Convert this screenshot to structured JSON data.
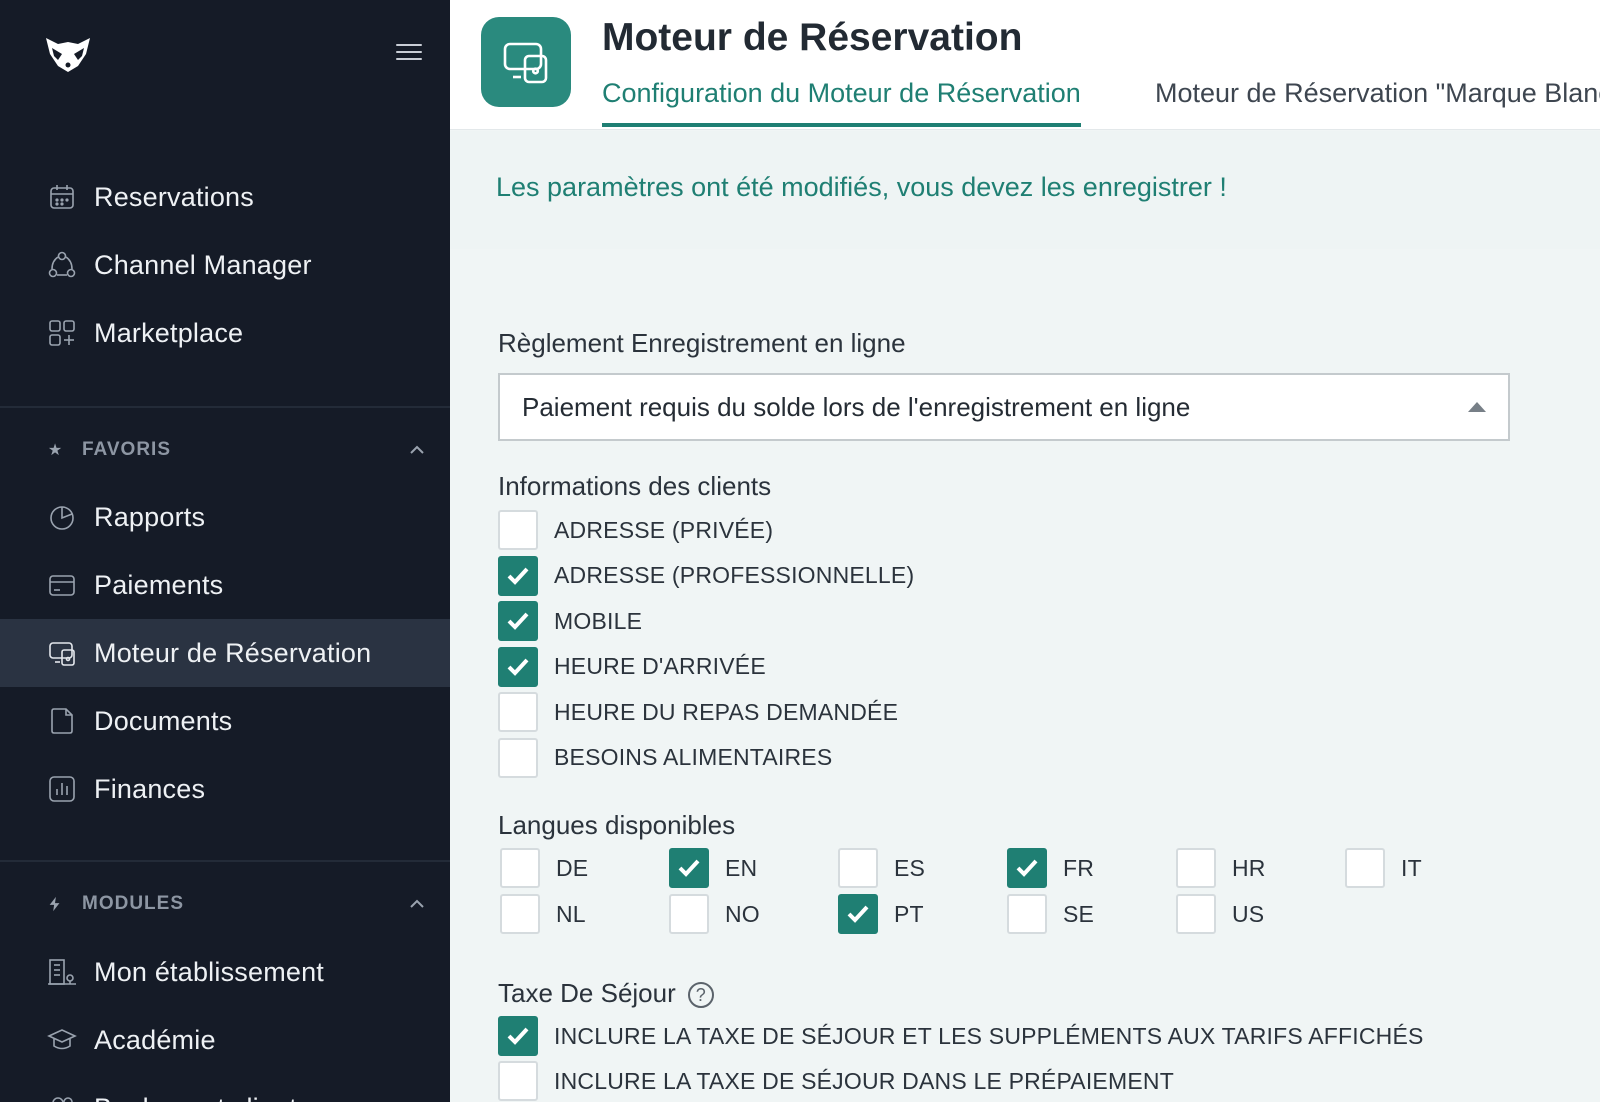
{
  "sidebar": {
    "logo_icon": "raccoon-logo-icon",
    "menu_icon": "hamburger-menu-icon",
    "top_items": [
      {
        "label": "Reservations",
        "icon": "calendar-icon"
      },
      {
        "label": "Channel Manager",
        "icon": "network-icon"
      },
      {
        "label": "Marketplace",
        "icon": "apps-grid-icon"
      }
    ],
    "favorites": {
      "title": "FAVORIS",
      "icon": "star-icon",
      "items": [
        {
          "label": "Rapports",
          "icon": "pie-chart-icon"
        },
        {
          "label": "Paiements",
          "icon": "credit-card-icon"
        },
        {
          "label": "Moteur de Réservation",
          "icon": "booking-engine-icon",
          "active": true
        },
        {
          "label": "Documents",
          "icon": "document-icon"
        },
        {
          "label": "Finances",
          "icon": "bar-chart-icon"
        }
      ]
    },
    "modules": {
      "title": "MODULES",
      "icon": "lightning-icon",
      "items": [
        {
          "label": "Mon établissement",
          "icon": "building-icon"
        },
        {
          "label": "Académie",
          "icon": "graduation-cap-icon"
        },
        {
          "label": "Bookers et clients",
          "icon": "users-icon"
        }
      ]
    }
  },
  "header": {
    "app_icon": "booking-engine-icon",
    "title": "Moteur de Réservation",
    "tabs": [
      {
        "label": "Configuration du Moteur de Réservation",
        "active": true
      },
      {
        "label": "Moteur de Réservation \"Marque Blanche\"",
        "active": false
      }
    ]
  },
  "main": {
    "notice": "Les paramètres ont été modifiés, vous devez les enregistrer !",
    "checkin_rule": {
      "label": "Règlement Enregistrement en ligne",
      "value": "Paiement requis du solde lors de l'enregistrement en ligne"
    },
    "client_info": {
      "label": "Informations des clients",
      "options": [
        {
          "label": "ADRESSE (PRIVÉE)",
          "checked": false
        },
        {
          "label": "ADRESSE (PROFESSIONNELLE)",
          "checked": true
        },
        {
          "label": "MOBILE",
          "checked": true
        },
        {
          "label": "HEURE D'ARRIVÉE",
          "checked": true
        },
        {
          "label": "HEURE DU REPAS DEMANDÉE",
          "checked": false
        },
        {
          "label": "BESOINS ALIMENTAIRES",
          "checked": false
        }
      ]
    },
    "languages": {
      "label": "Langues disponibles",
      "options": [
        {
          "label": "DE",
          "checked": false
        },
        {
          "label": "EN",
          "checked": true
        },
        {
          "label": "ES",
          "checked": false
        },
        {
          "label": "FR",
          "checked": true
        },
        {
          "label": "HR",
          "checked": false
        },
        {
          "label": "IT",
          "checked": false
        },
        {
          "label": "NL",
          "checked": false
        },
        {
          "label": "NO",
          "checked": false
        },
        {
          "label": "PT",
          "checked": true
        },
        {
          "label": "SE",
          "checked": false
        },
        {
          "label": "US",
          "checked": false
        }
      ]
    },
    "tourist_tax": {
      "label": "Taxe De Séjour",
      "help_icon": "question-circle-icon",
      "help_glyph": "?",
      "options": [
        {
          "label": "INCLURE LA TAXE DE SÉJOUR ET LES SUPPLÉMENTS AUX TARIFS AFFICHÉS",
          "checked": true
        },
        {
          "label": "INCLURE LA TAXE DE SÉJOUR DANS LE PRÉPAIEMENT",
          "checked": false
        }
      ]
    }
  },
  "colors": {
    "sidebar_bg": "#151b27",
    "sidebar_active": "#2a3342",
    "accent": "#1f7f73",
    "app_icon_bg": "#2a8a7e",
    "content_bg": "#f0f5f5"
  }
}
